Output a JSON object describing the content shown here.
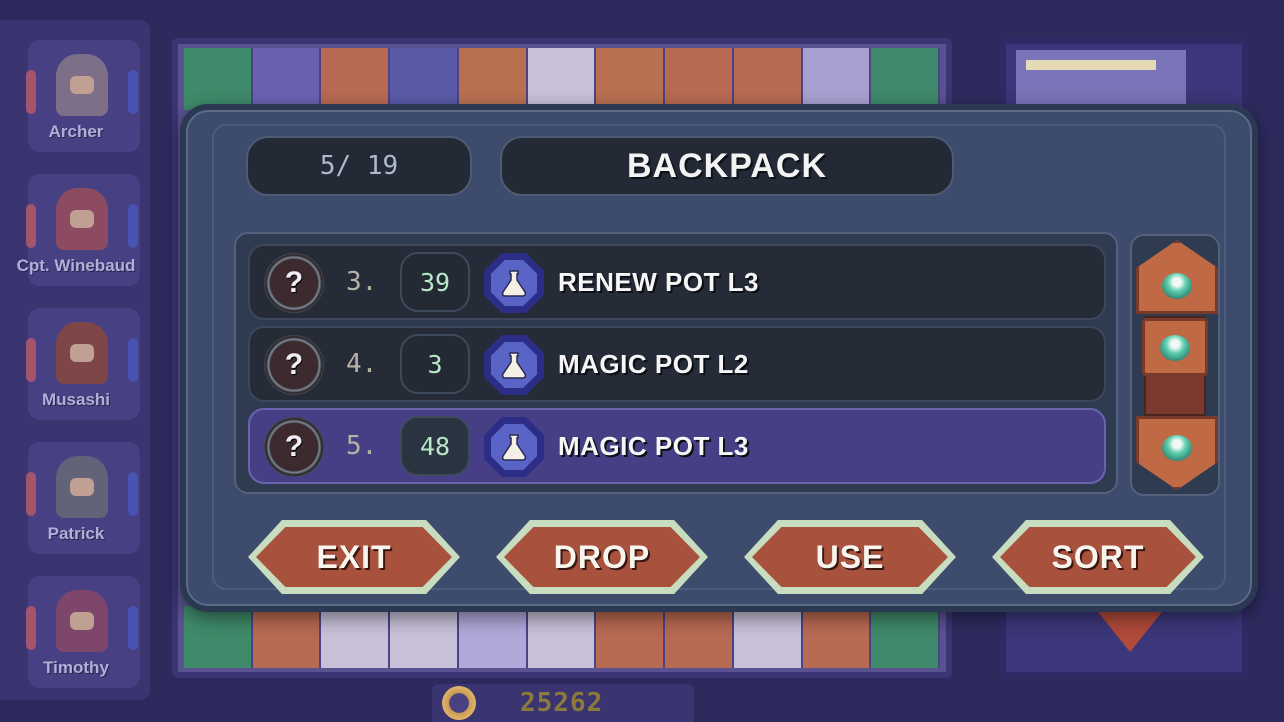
{
  "colors": {
    "accent": "#463f86",
    "button_face": "#a8523e",
    "button_rim": "#c8dcc0",
    "panel": "#3d4c6c",
    "quantity_text": "#b9e8c9"
  },
  "party": {
    "members": [
      {
        "name": "Archer"
      },
      {
        "name": "Cpt. Winebaud"
      },
      {
        "name": "Musashi"
      },
      {
        "name": "Patrick"
      },
      {
        "name": "Timothy"
      }
    ]
  },
  "gold": {
    "value": "25262",
    "icon": "coin-icon"
  },
  "backpack": {
    "count": "5/ 19",
    "title": "BACKPACK",
    "items": [
      {
        "index": "3.",
        "qty": "39",
        "name": "RENEW POT L3",
        "icon": "potion-flask-icon",
        "unknown_icon_label": "?",
        "selected": false
      },
      {
        "index": "4.",
        "qty": "3",
        "name": "MAGIC POT L2",
        "icon": "potion-flask-icon",
        "unknown_icon_label": "?",
        "selected": false
      },
      {
        "index": "5.",
        "qty": "48",
        "name": "MAGIC POT L3",
        "icon": "potion-flask-icon",
        "unknown_icon_label": "?",
        "selected": true
      }
    ],
    "scroll_icons": {
      "up": "scroll-up-gem-icon",
      "thumb": "scroll-thumb-gem-icon",
      "down": "scroll-down-gem-icon"
    }
  },
  "actions": {
    "exit": "EXIT",
    "drop": "DROP",
    "use": "USE",
    "sort": "SORT"
  }
}
